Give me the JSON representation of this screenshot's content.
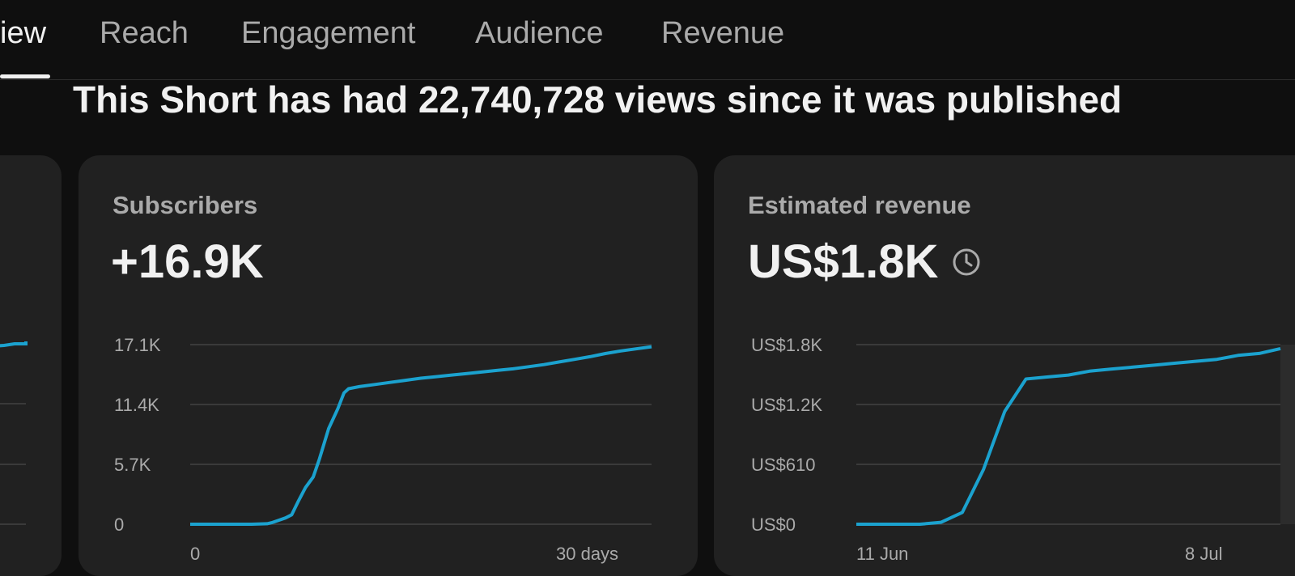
{
  "tabs": [
    {
      "label": "iew",
      "active": true
    },
    {
      "label": "Reach",
      "active": false
    },
    {
      "label": "Engagement",
      "active": false
    },
    {
      "label": "Audience",
      "active": false
    },
    {
      "label": "Revenue",
      "active": false
    }
  ],
  "headline": "This Short has had 22,740,728 views since it was published",
  "colors": {
    "background": "#0f0f0f",
    "card": "#212121",
    "line": "#1ba2cf",
    "grid": "#3a3a3a",
    "muted_text": "#aaaaaa",
    "text": "#f1f1f1"
  },
  "cards": {
    "subscribers": {
      "label": "Subscribers",
      "value": "+16.9K"
    },
    "revenue": {
      "label": "Estimated revenue",
      "value": "US$1.8K",
      "icon": "clock-icon"
    }
  },
  "chart_data": [
    {
      "type": "line",
      "title": "Subscribers",
      "y_ticks": [
        "0",
        "5.7K",
        "11.4K",
        "17.1K"
      ],
      "y_tick_values": [
        0,
        5700,
        11400,
        17100
      ],
      "x_tick_labels": [
        "0",
        "30 days"
      ],
      "ylim": [
        0,
        17100
      ],
      "xlim": [
        0,
        30
      ],
      "grid": true,
      "series": [
        {
          "x": [
            0,
            4,
            5,
            5.3,
            5.7,
            6.2,
            6.6,
            7.0,
            7.5,
            8.0,
            8.4,
            9.0,
            9.6,
            10.0,
            10.3,
            11,
            12,
            13,
            14,
            15,
            16,
            17,
            18,
            19,
            20,
            21,
            22,
            23,
            24,
            25,
            26,
            27,
            28,
            29,
            30
          ],
          "y": [
            0,
            0,
            50,
            150,
            350,
            600,
            900,
            2100,
            3500,
            4500,
            6200,
            9100,
            11000,
            12500,
            12900,
            13100,
            13300,
            13500,
            13700,
            13900,
            14050,
            14200,
            14350,
            14500,
            14650,
            14800,
            15000,
            15200,
            15450,
            15700,
            15950,
            16250,
            16500,
            16700,
            16900
          ]
        }
      ]
    },
    {
      "type": "line",
      "title": "Estimated revenue",
      "y_ticks": [
        "US$0",
        "US$610",
        "US$1.2K",
        "US$1.8K"
      ],
      "y_tick_values": [
        0,
        610,
        1220,
        1830
      ],
      "x_tick_labels": [
        "11 Jun",
        "8 Jul"
      ],
      "ylim": [
        0,
        1830
      ],
      "xlim": [
        0,
        20
      ],
      "grid": true,
      "series": [
        {
          "x": [
            0,
            3,
            4,
            5,
            6,
            7,
            8,
            9,
            10,
            11,
            12,
            13,
            14,
            15,
            16,
            17,
            18,
            19,
            20
          ],
          "y": [
            0,
            0,
            20,
            120,
            560,
            1150,
            1480,
            1500,
            1520,
            1560,
            1580,
            1600,
            1620,
            1640,
            1660,
            1680,
            1720,
            1740,
            1790
          ]
        }
      ]
    }
  ]
}
